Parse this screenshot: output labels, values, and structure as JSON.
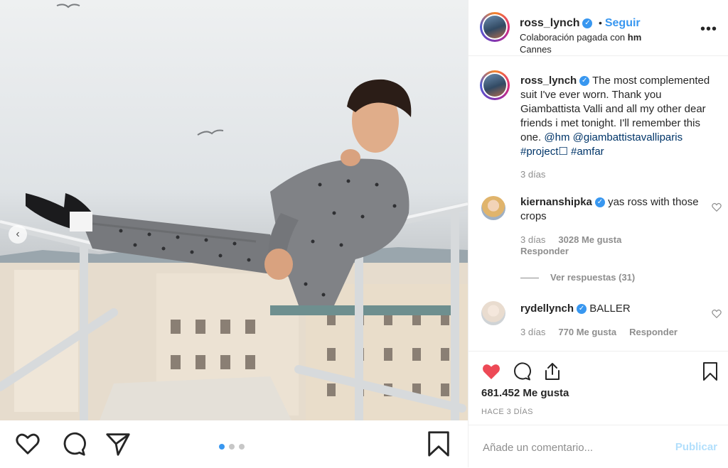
{
  "post": {
    "username": "ross_lynch",
    "follow_label": "Seguir",
    "separator": "•",
    "paid_partnership_prefix": "Colaboración pagada con",
    "partner": "hm",
    "location": "Cannes",
    "more_icon": "more-horizontal-icon"
  },
  "caption": {
    "username": "ross_lynch",
    "text_parts": [
      "The most complemented suit I've ever worn. Thank you Giambattista Valli and all my other dear friends i met tonight. I'll remember this one.",
      "@hm",
      "@giambattistavalliparis",
      "#project☐",
      "#amfar"
    ],
    "time": "3 días"
  },
  "comments": [
    {
      "username": "kiernanshipka",
      "text": "yas ross with those crops",
      "time": "3 días",
      "likes": "3028 Me gusta",
      "reply": "Responder",
      "view_replies": "Ver respuestas (31)"
    },
    {
      "username": "rydellynch",
      "text": "BALLER",
      "time": "3 días",
      "likes": "770 Me gusta",
      "reply": "Responder"
    }
  ],
  "stats": {
    "likes": "681.452 Me gusta",
    "ago": "HACE 3 DÍAS"
  },
  "composer": {
    "placeholder": "Añade un comentario...",
    "publish_label": "Publicar"
  },
  "carousel": {
    "total": 3,
    "active": 1,
    "accent": "#3897f0"
  },
  "colors": {
    "heart_liked": "#ed4956",
    "link": "#003569",
    "verified": "#3897f0"
  }
}
